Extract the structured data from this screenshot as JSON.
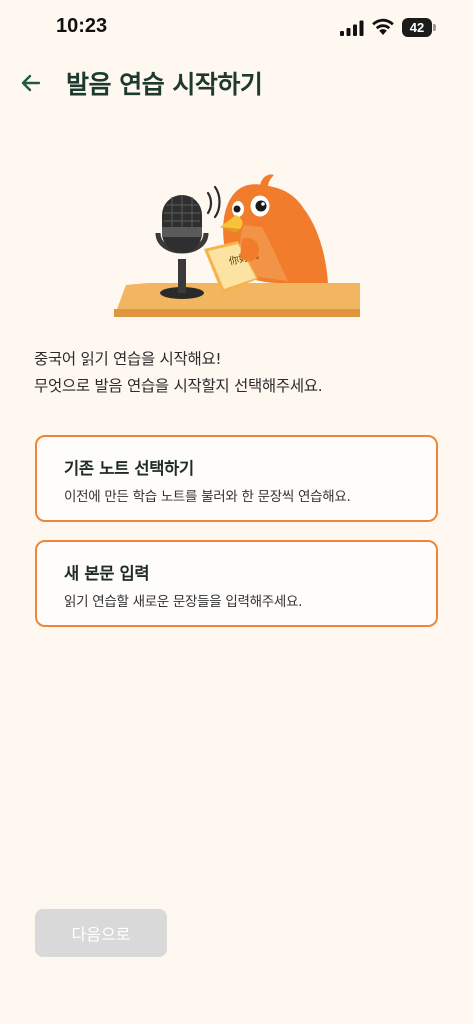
{
  "status_bar": {
    "time": "10:23",
    "battery": "42",
    "icons": [
      "signal-icon",
      "wifi-icon",
      "battery-icon"
    ]
  },
  "header": {
    "back_icon": "arrow-left-icon",
    "title": "발음 연습 시작하기"
  },
  "illustration": {
    "description_icon": "bird-reading-microphone-illustration",
    "book_text": "你好我"
  },
  "intro": {
    "line1": "중국어 읽기 연습을 시작해요!",
    "line2": "무엇으로 발음 연습을 시작할지 선택해주세요."
  },
  "options": [
    {
      "title": "기존 노트 선택하기",
      "description": "이전에 만든 학습 노트를 불러와 한 문장씩 연습해요."
    },
    {
      "title": "새 본문 입력",
      "description": "읽기 연습할 새로운 문장들을 입력해주세요."
    }
  ],
  "next_button": {
    "label": "다음으로",
    "enabled": false
  },
  "colors": {
    "background": "#fff8f1",
    "accent": "#f0853a",
    "title": "#1e3a2e",
    "disabled_button": "#d9d9d9"
  }
}
